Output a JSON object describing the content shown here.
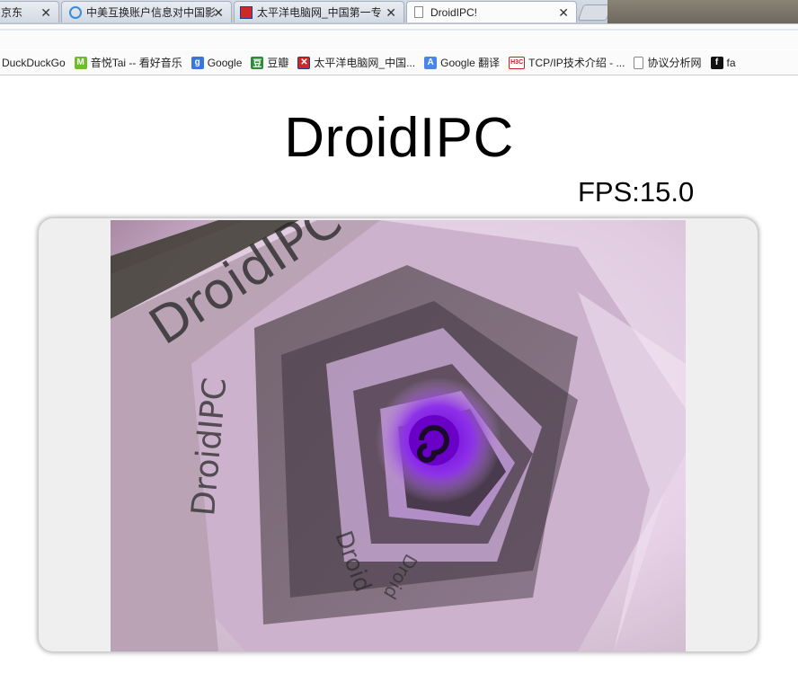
{
  "tabs": [
    {
      "title": "京东",
      "active": false
    },
    {
      "title": "中美互换账户信息对中国影",
      "active": false
    },
    {
      "title": "太平洋电脑网_中国第一专",
      "active": false
    },
    {
      "title": "DroidIPC!",
      "active": true
    }
  ],
  "bookmarks": [
    {
      "label": "DuckDuckGo",
      "icon": "duckduckgo-icon"
    },
    {
      "label": "音悦Tai -- 看好音乐",
      "icon": "yinyuetai-icon"
    },
    {
      "label": "Google",
      "icon": "google-icon"
    },
    {
      "label": "豆瓣",
      "icon": "douban-icon"
    },
    {
      "label": "太平洋电脑网_中国...",
      "icon": "pconline-icon"
    },
    {
      "label": "Google 翻译",
      "icon": "google-translate-icon"
    },
    {
      "label": "TCP/IP技术介绍 - ...",
      "icon": "h3c-icon"
    },
    {
      "label": "协议分析网",
      "icon": "page-icon"
    },
    {
      "label": "fa",
      "icon": "facebook-icon"
    }
  ],
  "page": {
    "title": "DroidIPC",
    "fps": "FPS:15.0"
  },
  "video": {
    "overlay_texts": [
      "DroidIPC",
      "DroidIPC",
      "Droid",
      "Droid"
    ]
  },
  "colors": {
    "tabstrip": "#c3cad6",
    "panel": "#efefef",
    "video_accent": "#7a10d8"
  }
}
